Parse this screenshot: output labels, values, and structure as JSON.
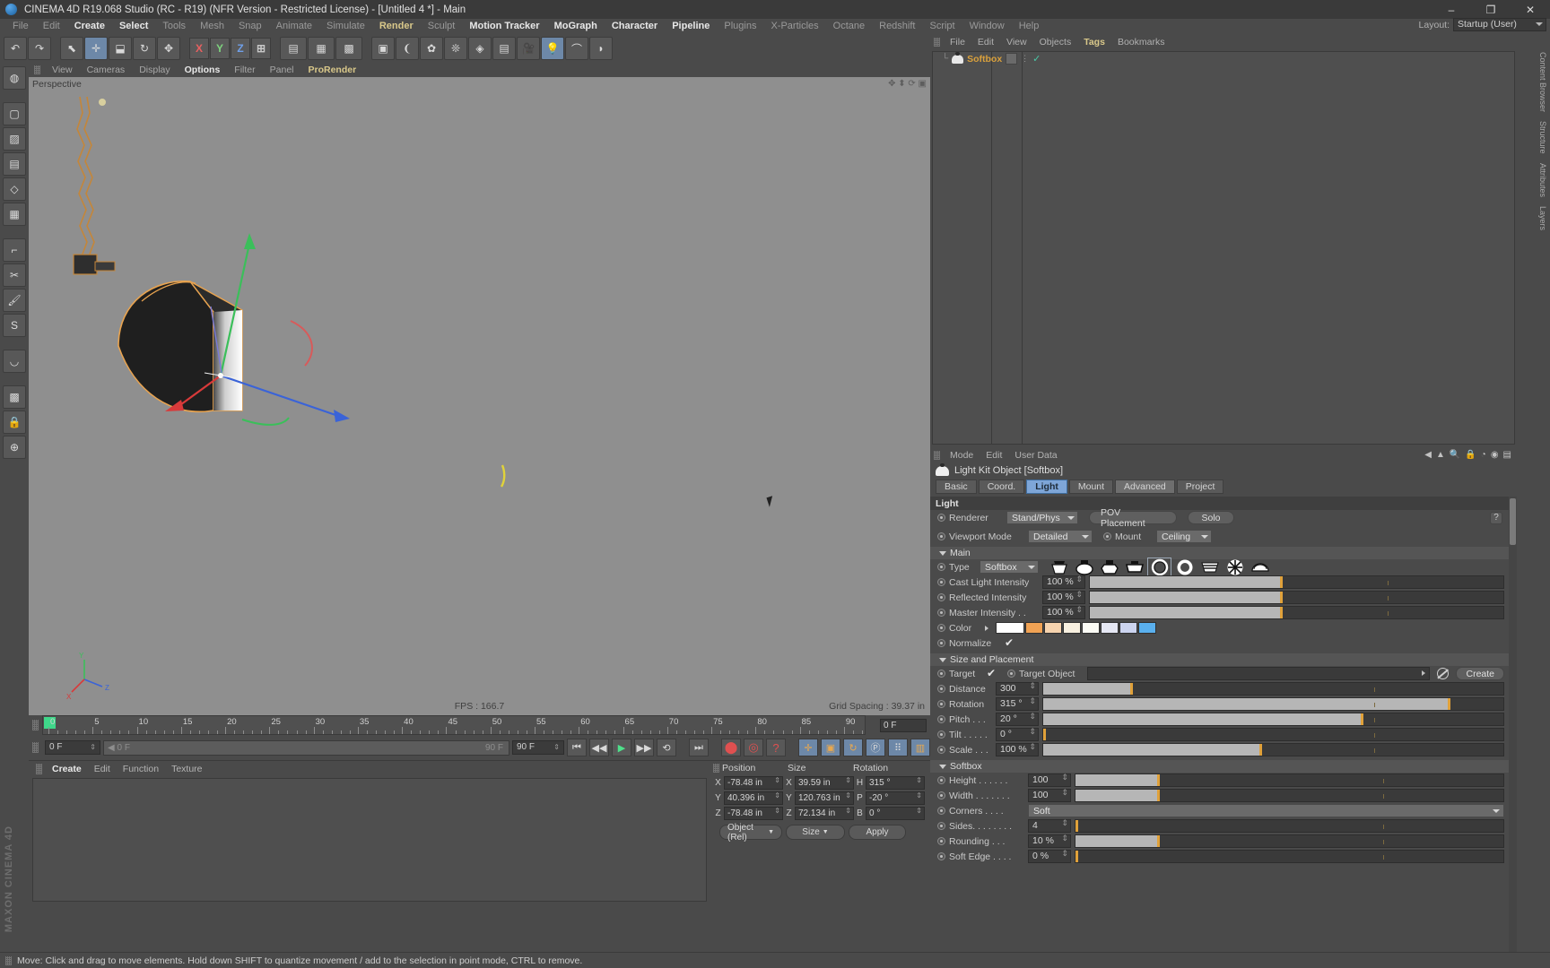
{
  "window": {
    "title": "CINEMA 4D R19.068 Studio (RC - R19) (NFR Version - Restricted License) - [Untitled 4 *] - Main",
    "minimize": "–",
    "maximize": "❐",
    "close": "✕"
  },
  "menubar": {
    "items": [
      {
        "label": "File",
        "style": "dim"
      },
      {
        "label": "Edit",
        "style": "dim"
      },
      {
        "label": "Create",
        "style": "hi"
      },
      {
        "label": "Select",
        "style": "hi"
      },
      {
        "label": "Tools",
        "style": "dim"
      },
      {
        "label": "Mesh",
        "style": "dim"
      },
      {
        "label": "Snap",
        "style": "dim"
      },
      {
        "label": "Animate",
        "style": "dim"
      },
      {
        "label": "Simulate",
        "style": "dim"
      },
      {
        "label": "Render",
        "style": "gold"
      },
      {
        "label": "Sculpt",
        "style": "dim"
      },
      {
        "label": "Motion Tracker",
        "style": "hi"
      },
      {
        "label": "MoGraph",
        "style": "hi"
      },
      {
        "label": "Character",
        "style": "hi"
      },
      {
        "label": "Pipeline",
        "style": "hi"
      },
      {
        "label": "Plugins",
        "style": "dim"
      },
      {
        "label": "X-Particles",
        "style": "dim"
      },
      {
        "label": "Octane",
        "style": "dim"
      },
      {
        "label": "Redshift",
        "style": "dim"
      },
      {
        "label": "Script",
        "style": "dim"
      },
      {
        "label": "Window",
        "style": "dim"
      },
      {
        "label": "Help",
        "style": "dim"
      }
    ],
    "layout_label": "Layout:",
    "layout_value": "Startup (User)"
  },
  "viewport": {
    "menu": [
      {
        "label": "View",
        "style": "dim"
      },
      {
        "label": "Cameras",
        "style": "dim"
      },
      {
        "label": "Display",
        "style": "dim"
      },
      {
        "label": "Options",
        "style": "hi"
      },
      {
        "label": "Filter",
        "style": "dim"
      },
      {
        "label": "Panel",
        "style": "dim"
      },
      {
        "label": "ProRender",
        "style": "gold"
      }
    ],
    "label": "Perspective",
    "fps": "FPS : 166.7",
    "grid_spacing": "Grid Spacing : 39.37 in"
  },
  "timeline": {
    "ticks": [
      "0",
      "5",
      "10",
      "15",
      "20",
      "25",
      "30",
      "35",
      "40",
      "45",
      "50",
      "55",
      "60",
      "65",
      "70",
      "75",
      "80",
      "85",
      "90"
    ],
    "end_field": "0 F",
    "current_frame": "0 F",
    "scrub_value": "0 F",
    "range_left": "0 F",
    "range_right": "90 F",
    "marker_right": "90 F"
  },
  "material_manager": {
    "menu": [
      "Create",
      "Edit",
      "Function",
      "Texture"
    ]
  },
  "coordinates": {
    "headers": {
      "position": "Position",
      "size": "Size",
      "rotation": "Rotation"
    },
    "rows": [
      {
        "axis": "X",
        "position": "-78.48 in",
        "size_axis": "X",
        "size": "39.59 in",
        "rot_axis": "H",
        "rotation": "315 °"
      },
      {
        "axis": "Y",
        "position": "40.396 in",
        "size_axis": "Y",
        "size": "120.763 in",
        "rot_axis": "P",
        "rotation": "-20 °"
      },
      {
        "axis": "Z",
        "position": "-78.48 in",
        "size_axis": "Z",
        "size": "72.134 in",
        "rot_axis": "B",
        "rotation": "0 °"
      }
    ],
    "mode": "Object (Rel)",
    "size_mode": "Size",
    "apply": "Apply"
  },
  "status": {
    "text": "Move: Click and drag to move elements. Hold down SHIFT to quantize movement / add to the selection in point mode, CTRL to remove."
  },
  "object_manager": {
    "menu": [
      "File",
      "Edit",
      "View",
      "Objects",
      "Tags",
      "Bookmarks"
    ],
    "objects": [
      {
        "name": "Softbox"
      }
    ]
  },
  "right_tabs": [
    "Content Browser",
    "Structure",
    "Attributes",
    "Layers"
  ],
  "attribute_manager": {
    "menu": [
      "Mode",
      "Edit",
      "User Data"
    ],
    "object_title": "Light Kit Object [Softbox]",
    "tabs": [
      {
        "label": "Basic",
        "active": false
      },
      {
        "label": "Coord.",
        "active": false
      },
      {
        "label": "Light",
        "active": true
      },
      {
        "label": "Mount",
        "active": false
      },
      {
        "label": "Advanced",
        "active": false
      },
      {
        "label": "Project",
        "active": false
      }
    ],
    "section_light": "Light",
    "renderer_label": "Renderer",
    "renderer_value": "Stand/Phys",
    "pov_placement": "POV Placement",
    "solo": "Solo",
    "help": "?",
    "viewport_mode_label": "Viewport Mode",
    "viewport_mode_value": "Detailed",
    "mount_label": "Mount",
    "mount_value": "Ceiling",
    "group_main": "Main",
    "type_label": "Type",
    "type_value": "Softbox",
    "type_icons": [
      "softbox-icon",
      "beauty-dish-icon",
      "octabox-icon",
      "stripbox-icon",
      "ring-open-icon",
      "ring-filled-icon",
      "striped-box-icon",
      "umbrella-icon",
      "dome-icon"
    ],
    "type_selected_index": 4,
    "sliders_main": [
      {
        "label": "Cast Light Intensity",
        "value": "100 %",
        "fill": 46,
        "knob": 46
      },
      {
        "label": "Reflected Intensity",
        "value": "100 %",
        "fill": 46,
        "knob": 46
      },
      {
        "label": "Master Intensity  . .",
        "value": "100 %",
        "fill": 46,
        "knob": 46
      }
    ],
    "color_label": "Color",
    "color_swatches": [
      "#ffffff",
      "#f0a254",
      "#f6d3ae",
      "#f8f0e0",
      "#fbfbf5",
      "#e6e8f4",
      "#ccd4ef",
      "#5ab0ee"
    ],
    "normalize_label": "Normalize",
    "group_size_placement": "Size and Placement",
    "target_label": "Target",
    "target_object_label": "Target Object",
    "target_object_value": "",
    "create_button": "Create",
    "sliders_placement": [
      {
        "label": "Distance",
        "value": "300",
        "fill": 19,
        "knob": 19
      },
      {
        "label": "Rotation",
        "value": "315 °",
        "fill": 88,
        "knob": 88
      },
      {
        "label": "Pitch . . .",
        "value": "20 °",
        "fill": 69,
        "knob": 69
      },
      {
        "label": "Tilt . . . . .",
        "value": "0 °",
        "fill": 0,
        "knob": 0
      },
      {
        "label": "Scale . . .",
        "value": "100 %",
        "fill": 47,
        "knob": 47
      }
    ],
    "group_softbox": "Softbox",
    "sliders_softbox": [
      {
        "label": "Height . . . . . .",
        "value": "100",
        "fill": 19,
        "knob": 19
      },
      {
        "label": "Width . . . . . . .",
        "value": "100",
        "fill": 19,
        "knob": 19
      }
    ],
    "corners_label": "Corners  . . . .",
    "corners_value": "Soft",
    "sliders_softbox2": [
      {
        "label": "Sides. . . . . . . .",
        "value": "4",
        "fill": 0,
        "knob": 0
      },
      {
        "label": "Rounding . . .",
        "value": "10 %",
        "fill": 19,
        "knob": 19
      },
      {
        "label": "Soft Edge . . . .",
        "value": "0 %",
        "fill": 0,
        "knob": 0
      }
    ]
  },
  "toolbar": {
    "axis_buttons": [
      "X",
      "Y",
      "Z"
    ],
    "icons": [
      "undo-icon",
      "redo-icon",
      "select-live-icon",
      "move-icon",
      "scale-icon",
      "rotate-icon",
      "world-axis-icon",
      "render-view-icon",
      "render-region-icon",
      "render-settings-icon",
      "cube-icon",
      "spline-icon",
      "generator-icon",
      "deformer-icon",
      "environment-icon",
      "camera-icon",
      "light-icon",
      "stage-icon",
      "material-icon"
    ]
  },
  "left_tools": [
    "select-live-icon",
    "box-icon",
    "texture-icon",
    "layers-icon",
    "poly-icon",
    "cube-prim-icon",
    "ruler-icon",
    "knife-icon",
    "brush-icon",
    "sculpt-icon",
    "magnet-icon",
    "grid-icon",
    "lock-icon",
    "axis-icon"
  ]
}
